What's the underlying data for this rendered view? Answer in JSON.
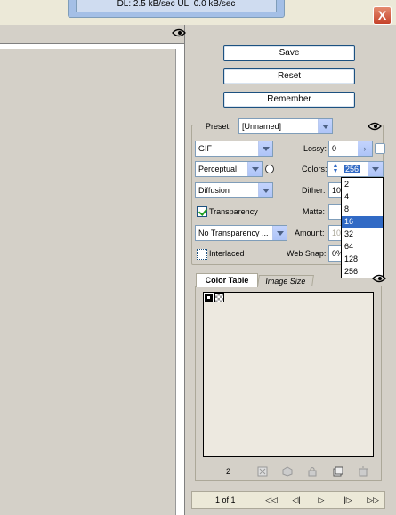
{
  "status": {
    "text": "DL: 2.5 kB/sec  UL: 0.0 kB/sec"
  },
  "window": {
    "close_label": "X"
  },
  "buttons": {
    "save": "Save",
    "reset": "Reset",
    "remember": "Remember"
  },
  "preset": {
    "label": "Preset:",
    "value": "[Unnamed]"
  },
  "format": {
    "value": "GIF"
  },
  "lossy": {
    "label": "Lossy:",
    "value": "0"
  },
  "reduction": {
    "value": "Perceptual"
  },
  "colors": {
    "label": "Colors:",
    "value": "256",
    "options": [
      "2",
      "4",
      "8",
      "16",
      "32",
      "64",
      "128",
      "256"
    ],
    "highlighted": "16"
  },
  "dither_method": {
    "value": "Diffusion"
  },
  "dither": {
    "label": "Dither:",
    "value": "10"
  },
  "transparency": {
    "label": "Transparency",
    "checked": true
  },
  "matte": {
    "label": "Matte:"
  },
  "transparency_dither": {
    "value": "No Transparency ..."
  },
  "amount": {
    "label": "Amount:",
    "value": "10"
  },
  "interlaced": {
    "label": "Interlaced",
    "checked": false
  },
  "web_snap": {
    "label": "Web Snap:",
    "value": "0%"
  },
  "tabs": {
    "color_table": "Color Table",
    "image_size": "Image Size"
  },
  "color_table": {
    "count": "2",
    "swatch_colors": [
      "#000000",
      "transparent"
    ]
  },
  "navigation": {
    "page": "1 of 1",
    "first": "◁◁",
    "prev": "◁|",
    "play": "▷",
    "next": "|▷",
    "last": "▷▷"
  },
  "colors_palette": {
    "accent": "#316ac5",
    "border": "#7f9db9",
    "background": "#d4d0c8"
  }
}
